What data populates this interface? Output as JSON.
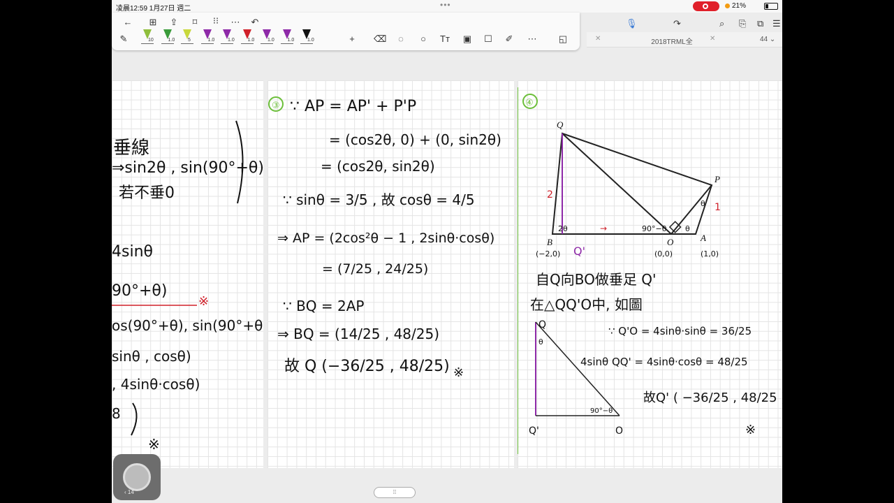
{
  "status_bar": {
    "time": "凌晨12:59   1月27日 週二",
    "battery": "21%"
  },
  "toolbar": {
    "pens": [
      {
        "size": "10",
        "color": "#8fbe3c"
      },
      {
        "size": "1.0",
        "color": "#3a9b3a"
      },
      {
        "size": "5",
        "color": "#c8d83c"
      },
      {
        "size": "1.0",
        "color": "#8e2aa8"
      },
      {
        "size": "1.0",
        "color": "#8e2aa8"
      },
      {
        "size": "1.0",
        "color": "#d0202a"
      },
      {
        "size": "1.0",
        "color": "#8e2aa8"
      },
      {
        "size": "1.0",
        "color": "#8e2aa8"
      },
      {
        "size": "1.0",
        "color": "#111111"
      }
    ]
  },
  "document": {
    "title": "2018TRML全",
    "page_count": "44"
  },
  "page_left": {
    "lines": [
      "垂線",
      "⇒sin2θ , sin(90°+θ)",
      "若不垂0",
      "4sinθ",
      "90°+θ)",
      "※",
      "os(90°+θ), sin(90°+θ))",
      "sinθ , cosθ)",
      ", 4sinθ·cosθ)",
      "8",
      "※"
    ]
  },
  "page_mid": {
    "label": "③",
    "lines": [
      "∵ AP = AP' + P'P",
      "= (cos2θ, 0) + (0, sin2θ)",
      "= (cos2θ, sin2θ)",
      "∵ sinθ = 3/5 , 故 cosθ = 4/5",
      "⇒ AP = (2cos²θ − 1 , 2sinθ·cosθ)",
      "= (7/25 , 24/25)",
      "∵ BQ = 2AP",
      "⇒ BQ = (14/25 , 48/25)",
      "故 Q (−36/25 , 48/25)",
      "※"
    ]
  },
  "page_right": {
    "label": "④",
    "diagram": {
      "points": {
        "Q": "Q",
        "P": "P",
        "B": "B",
        "O": "O",
        "A": "A",
        "Qp": "Q'"
      },
      "coords": {
        "B": "(−2,0)",
        "O": "(0,0)",
        "A": "(1,0)"
      },
      "marks": {
        "two": "2",
        "one": "1",
        "theta": "θ",
        "two_theta": "2θ",
        "ninety": "90°−θ",
        "arrow": "→"
      }
    },
    "lines": [
      "自Q向BO做垂足 Q'",
      "在△QQ'O中, 如圖",
      "∵ Q'O = 4sinθ·sinθ = 36/25",
      "4sinθ   QQ' = 4sinθ·cosθ = 48/25",
      "故Q' ( −36/25 , 48/25 )",
      "※"
    ]
  },
  "widget": {
    "label": "14"
  }
}
